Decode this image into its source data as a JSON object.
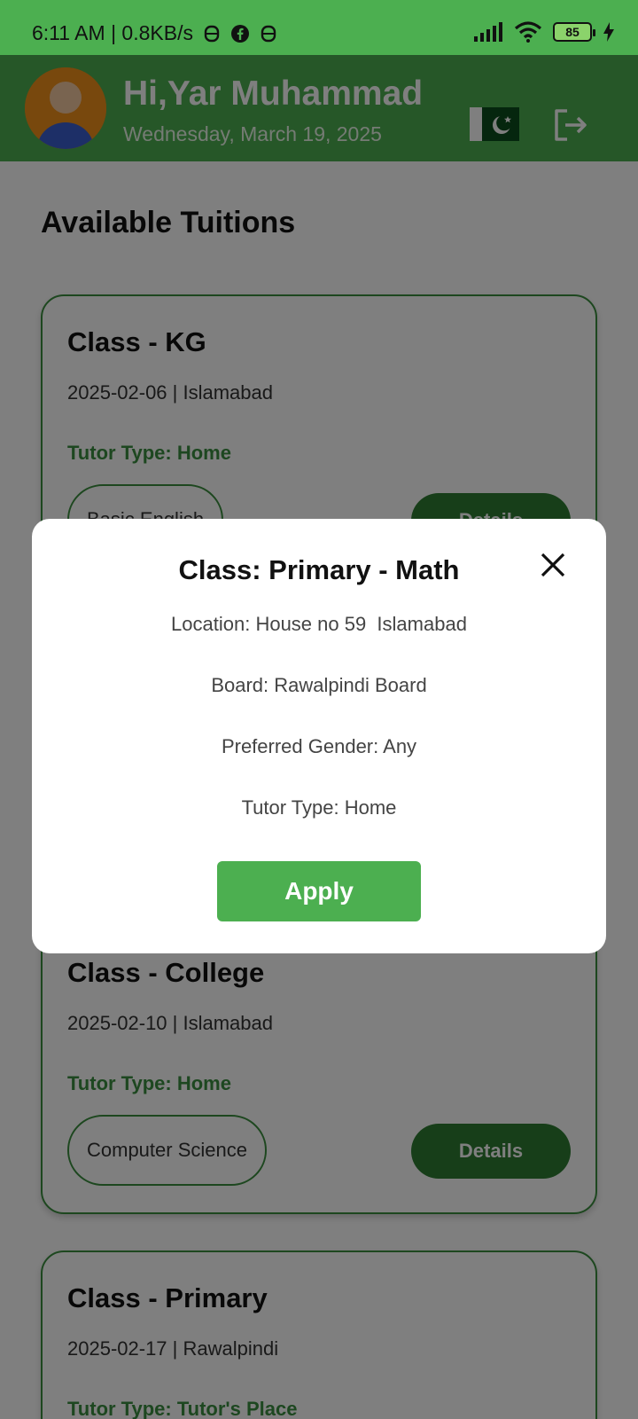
{
  "status_bar": {
    "time_speed": "6:11 AM | 0.8KB/s",
    "battery": "85"
  },
  "header": {
    "greeting": "Hi,Yar Muhammad",
    "date": "Wednesday, March 19, 2025"
  },
  "main": {
    "section_title": "Available Tuitions",
    "cards": [
      {
        "title": "Class - KG",
        "meta": "2025-02-06 | Islamabad",
        "tutor_type": "Tutor Type: Home",
        "subject": "Basic English",
        "button": "Details"
      },
      {
        "title": "Class - College",
        "meta": "2025-02-10 | Islamabad",
        "tutor_type": "Tutor Type: Home",
        "subject": "Computer Science",
        "button": "Details"
      },
      {
        "title": "Class - Primary",
        "meta": "2025-02-17 | Rawalpindi",
        "tutor_type": "Tutor Type: Tutor's Place"
      }
    ]
  },
  "dialog": {
    "title": "Class: Primary - Math",
    "location": "Location: House no 59  Islamabad",
    "board": "Board: Rawalpindi Board",
    "gender": "Preferred Gender: Any",
    "tutor_type": "Tutor Type: Home",
    "apply_label": "Apply"
  },
  "colors": {
    "primary_green": "#4caf50",
    "dark_green": "#2e7d32",
    "scrim": "rgba(0,0,0,0.5)"
  },
  "icons": [
    "data-icon",
    "facebook-icon",
    "signal-icon",
    "wifi-icon",
    "battery-icon",
    "charging-icon",
    "avatar-icon",
    "pakistan-flag-icon",
    "logout-icon",
    "close-icon"
  ]
}
